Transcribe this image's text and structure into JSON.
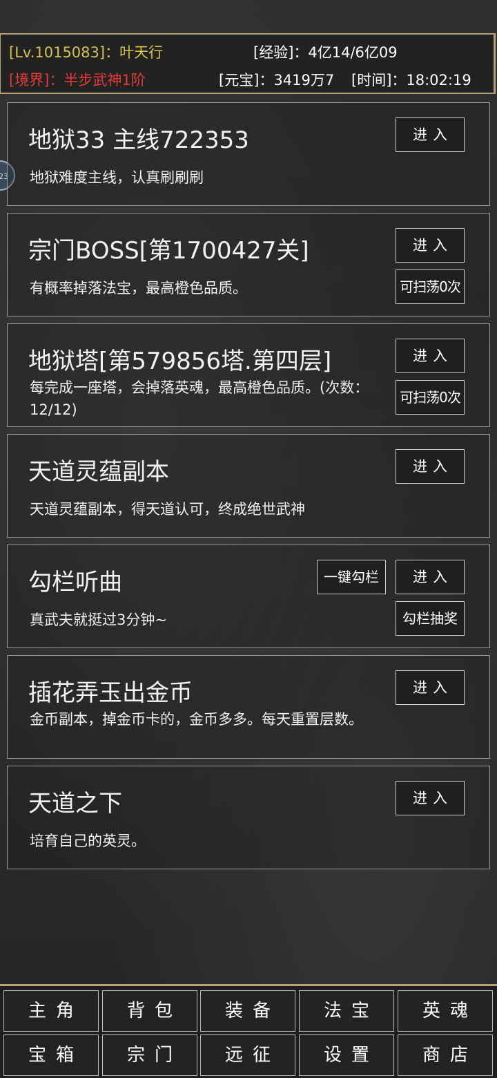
{
  "status": {
    "level": "[Lv.1015083]：叶天行",
    "realm": "[境界]：半步武神1阶",
    "exp": "[经验]：4亿14/6亿09",
    "gold": "[元宝]：3419万7",
    "time": "[时间]：18:02:19"
  },
  "float_badge": "23",
  "cards": [
    {
      "title": "地狱33 主线722353",
      "desc": "地狱难度主线，认真刷刷刷",
      "enter": "进入"
    },
    {
      "title": "宗门BOSS[第1700427关]",
      "desc": "有概率掉落法宝，最高橙色品质。",
      "enter": "进入",
      "sweep": "可扫荡0次"
    },
    {
      "title": "地狱塔[第579856塔.第四层]",
      "desc": "每完成一座塔，会掉落英魂，最高橙色品质。(次数：12/12)",
      "enter": "进入",
      "sweep": "可扫荡0次"
    },
    {
      "title": "天道灵蕴副本",
      "desc": "天道灵蕴副本，得天道认可，终成绝世武神",
      "enter": "进入"
    },
    {
      "title": "勾栏听曲",
      "desc": "真武夫就挺过3分钟~",
      "enter": "进入",
      "onekey": "一键勾栏",
      "lottery": "勾栏抽奖"
    },
    {
      "title": "插花弄玉出金币",
      "desc": "金币副本，掉金币卡的，金币多多。每天重置层数。",
      "enter": "进入"
    },
    {
      "title": "天道之下",
      "desc": "培育自己的英灵。",
      "enter": "进入"
    }
  ],
  "nav": {
    "row1": [
      "主角",
      "背包",
      "装备",
      "法宝",
      "英魂"
    ],
    "row2": [
      "宝箱",
      "宗门",
      "远征",
      "设置",
      "商店"
    ]
  }
}
